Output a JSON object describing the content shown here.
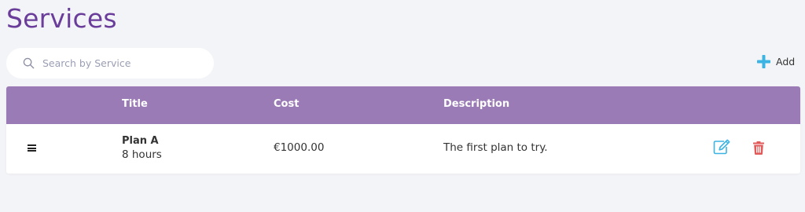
{
  "page": {
    "title": "Services"
  },
  "search": {
    "placeholder": "Search by Service",
    "value": ""
  },
  "toolbar": {
    "add_label": "Add"
  },
  "table": {
    "columns": [
      "",
      "Title",
      "Cost",
      "Description",
      ""
    ],
    "rows": [
      {
        "title": "Plan A",
        "duration": "8 hours",
        "cost": "€1000.00",
        "description": "The first plan to try."
      }
    ]
  },
  "icons": {
    "search": "search-icon",
    "add": "plus-icon",
    "drag": "drag-handle-icon",
    "edit": "edit-icon",
    "delete": "trash-icon"
  },
  "colors": {
    "title": "#6a3d9a",
    "header_bg": "#9b7bb5",
    "accent_blue": "#3bb3e3",
    "delete_red": "#e05a5a",
    "page_bg": "#f3f4f7"
  }
}
